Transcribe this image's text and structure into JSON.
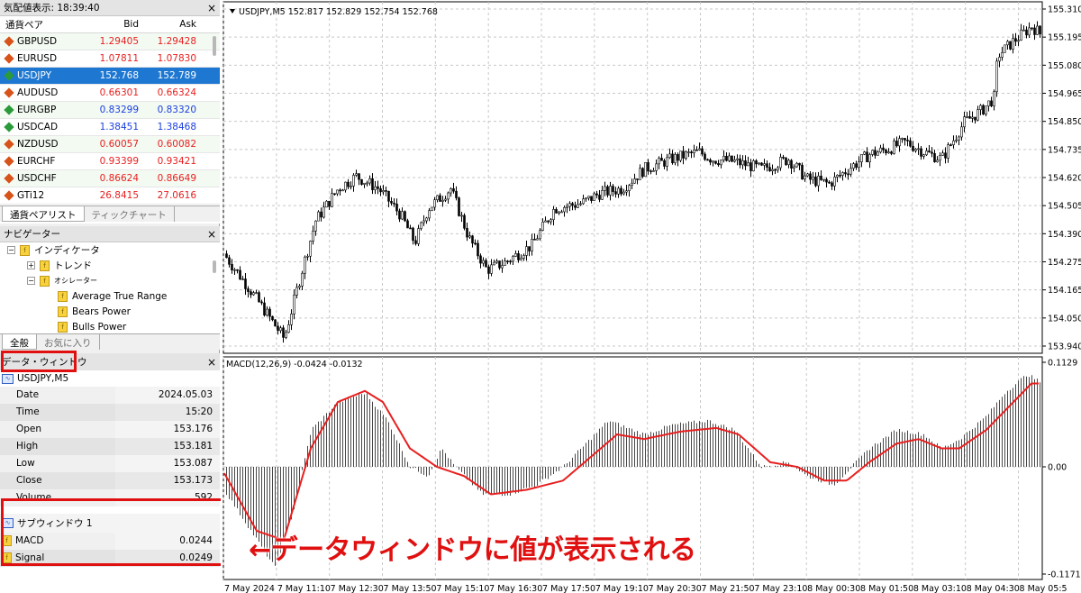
{
  "market_watch": {
    "title": "気配値表示: 18:39:40",
    "col_symbol": "通貨ペア",
    "col_bid": "Bid",
    "col_ask": "Ask",
    "rows": [
      {
        "symbol": "GBPUSD",
        "bid": "1.29405",
        "ask": "1.29428",
        "dir": "dn"
      },
      {
        "symbol": "EURUSD",
        "bid": "1.07811",
        "ask": "1.07830",
        "dir": "dn"
      },
      {
        "symbol": "USDJPY",
        "bid": "152.768",
        "ask": "152.789",
        "dir": "up"
      },
      {
        "symbol": "AUDUSD",
        "bid": "0.66301",
        "ask": "0.66324",
        "dir": "dn"
      },
      {
        "symbol": "EURGBP",
        "bid": "0.83299",
        "ask": "0.83320",
        "dir": "up"
      },
      {
        "symbol": "USDCAD",
        "bid": "1.38451",
        "ask": "1.38468",
        "dir": "up"
      },
      {
        "symbol": "NZDUSD",
        "bid": "0.60057",
        "ask": "0.60082",
        "dir": "dn"
      },
      {
        "symbol": "EURCHF",
        "bid": "0.93399",
        "ask": "0.93421",
        "dir": "dn"
      },
      {
        "symbol": "USDCHF",
        "bid": "0.86624",
        "ask": "0.86649",
        "dir": "dn"
      },
      {
        "symbol": "GTi12",
        "bid": "26.8415",
        "ask": "27.0616",
        "dir": "dn"
      }
    ],
    "tab_symbols": "通貨ペアリスト",
    "tab_tick": "ティックチャート"
  },
  "navigator": {
    "title": "ナビゲーター",
    "indicators": "インディケータ",
    "trend": "トレンド",
    "oscillators": "オシレーター",
    "items": [
      "Average True Range",
      "Bears Power",
      "Bulls Power"
    ],
    "tab_common": "全般",
    "tab_favorites": "お気に入り"
  },
  "data_window": {
    "title": "データ・ウィンドウ",
    "symbol": "USDJPY,M5",
    "rows": [
      {
        "key": "Date",
        "value": "2024.05.03"
      },
      {
        "key": "Time",
        "value": "15:20"
      },
      {
        "key": "Open",
        "value": "153.176"
      },
      {
        "key": "High",
        "value": "153.181"
      },
      {
        "key": "Low",
        "value": "153.087"
      },
      {
        "key": "Close",
        "value": "153.173"
      },
      {
        "key": "Volume",
        "value": "592"
      }
    ],
    "subwindow": "サブウィンドウ 1",
    "macd_label": "MACD",
    "macd_value": "0.0244",
    "signal_label": "Signal",
    "signal_value": "0.0249"
  },
  "chart": {
    "main_header": "USDJPY,M5  152.817 152.829 152.754 152.768",
    "macd_header": "MACD(12,26,9) -0.0424 -0.0132",
    "price_ticks": [
      "155.310",
      "155.195",
      "155.080",
      "154.965",
      "154.850",
      "154.735",
      "154.620",
      "154.505",
      "154.390",
      "154.275",
      "154.165",
      "154.050",
      "153.940"
    ],
    "macd_ticks": [
      "0.1129",
      "0.00",
      "-0.1171"
    ],
    "time_ticks": [
      "7 May 2024",
      "7 May 11:10",
      "7 May 12:30",
      "7 May 13:50",
      "7 May 15:10",
      "7 May 16:30",
      "7 May 17:50",
      "7 May 19:10",
      "7 May 20:30",
      "7 May 21:50",
      "7 May 23:10",
      "8 May 00:30",
      "8 May 01:50",
      "8 May 03:10",
      "8 May 04:30",
      "8 May 05:5"
    ],
    "bull_color": "#ffffff",
    "bear_color": "#000000",
    "signal_color": "#e81f1f"
  },
  "annotation": "←データウィンドウに値が表示される"
}
